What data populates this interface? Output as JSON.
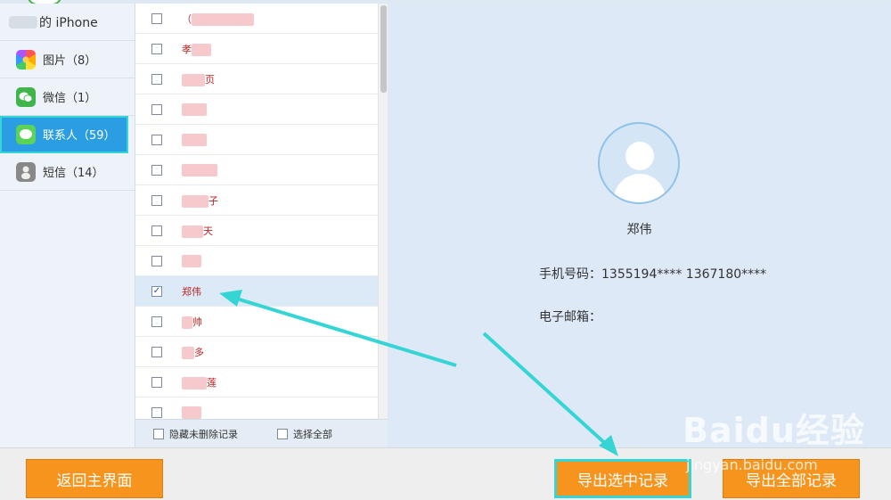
{
  "sidebar": {
    "device_label": "的 iPhone",
    "items": [
      {
        "label": "图片（8）",
        "icon": "photos-icon"
      },
      {
        "label": "微信（1）",
        "icon": "wechat-icon"
      },
      {
        "label": "联系人（59）",
        "icon": "messages-icon"
      },
      {
        "label": "短信（14）",
        "icon": "sms-icon"
      }
    ]
  },
  "contacts": {
    "rows": [
      {
        "name": "（",
        "checked": false
      },
      {
        "name": "孝",
        "checked": false
      },
      {
        "name": "页",
        "checked": false
      },
      {
        "name": "",
        "checked": false
      },
      {
        "name": "",
        "checked": false
      },
      {
        "name": "",
        "checked": false
      },
      {
        "name": "子",
        "checked": false
      },
      {
        "name": "天",
        "checked": false
      },
      {
        "name": "",
        "checked": false
      },
      {
        "name": "郑伟",
        "checked": true
      },
      {
        "name": "帅",
        "checked": false
      },
      {
        "name": "多",
        "checked": false
      },
      {
        "name": "莲",
        "checked": false
      },
      {
        "name": "",
        "checked": false
      }
    ],
    "footer": {
      "hide_deleted": "隐藏未删除记录",
      "select_all": "选择全部"
    }
  },
  "detail": {
    "name": "郑伟",
    "phone": "手机号码：1355194**** 1367180****",
    "email": "电子邮箱："
  },
  "buttons": {
    "home": "返回主界面",
    "export_selected": "导出选中记录",
    "export_all": "导出全部记录"
  },
  "watermark": {
    "brand": "Baidu经验",
    "url": "jingyan.baidu.com"
  },
  "colors": {
    "accent": "#2b9ee3",
    "button": "#f7941d",
    "highlight": "#35d5d6"
  }
}
